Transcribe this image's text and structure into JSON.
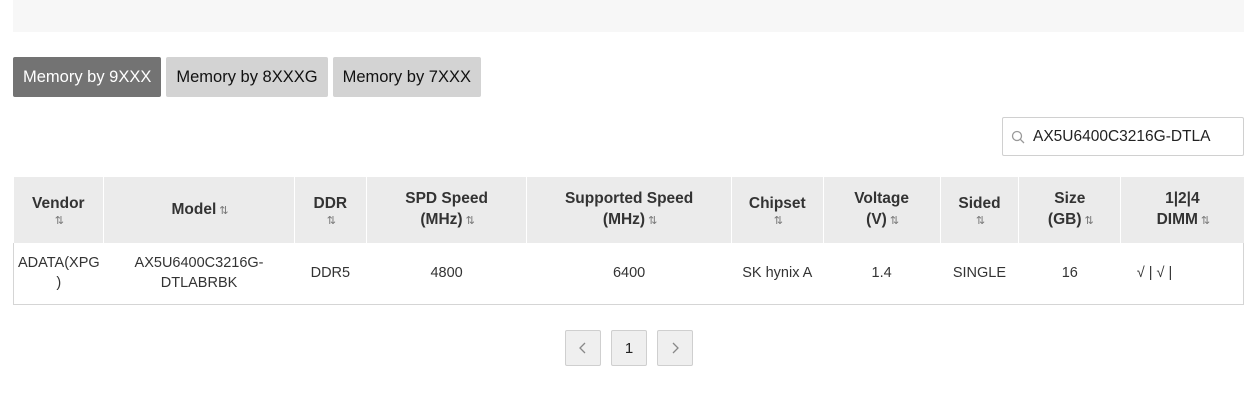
{
  "tabs": [
    {
      "label": "Memory by 9XXX",
      "active": true
    },
    {
      "label": "Memory by 8XXXG",
      "active": false
    },
    {
      "label": "Memory by 7XXX",
      "active": false
    }
  ],
  "search": {
    "value": "AX5U6400C3216G-DTLA",
    "icon": "search-icon"
  },
  "table": {
    "headers": [
      {
        "line1": "Vendor",
        "line2": ""
      },
      {
        "line1": "Model",
        "line2": ""
      },
      {
        "line1": "DDR",
        "line2": ""
      },
      {
        "line1": "SPD Speed",
        "line2": "(MHz)"
      },
      {
        "line1": "Supported Speed",
        "line2": "(MHz)"
      },
      {
        "line1": "Chipset",
        "line2": ""
      },
      {
        "line1": "Voltage",
        "line2": "(V)"
      },
      {
        "line1": "Sided",
        "line2": ""
      },
      {
        "line1": "Size",
        "line2": "(GB)"
      },
      {
        "line1": "1|2|4",
        "line2": "DIMM"
      }
    ],
    "sort_glyph": "⇅",
    "rows": [
      {
        "vendor": [
          "ADATA(XPG",
          ")"
        ],
        "model": [
          "AX5U6400C3216G-",
          "DTLABRBK"
        ],
        "ddr": "DDR5",
        "spd_speed": "4800",
        "supported_speed": "6400",
        "chipset": "SK hynix A",
        "voltage": "1.4",
        "sided": "SINGLE",
        "size": "16",
        "dimm": "√ | √ |"
      }
    ]
  },
  "pagination": {
    "prev_icon": "chevron-left-icon",
    "current": "1",
    "next_icon": "chevron-right-icon"
  }
}
